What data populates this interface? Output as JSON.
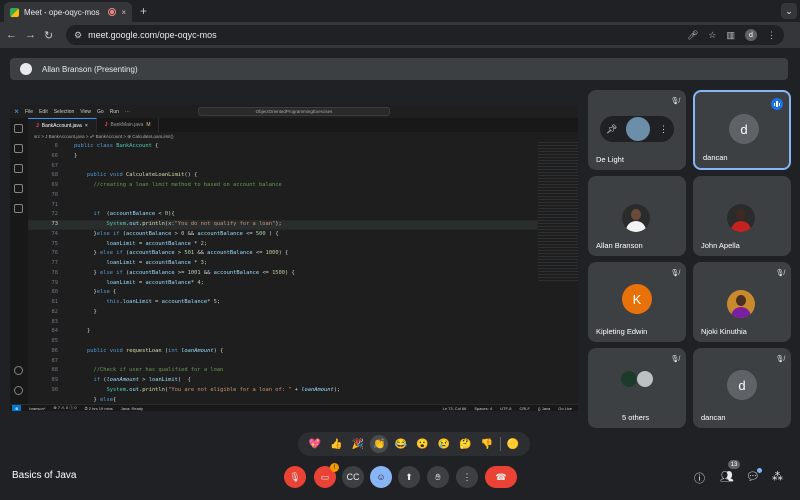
{
  "browser": {
    "tab_title": "Meet - ope-oqyc-mos",
    "new_tab": "+",
    "tab_menu": "⌄",
    "url": "meet.google.com/ope-oqyc-mos",
    "profile_initial": "d"
  },
  "banner": {
    "text": "Allan Branson (Presenting)"
  },
  "vscode": {
    "menu": [
      "File",
      "Edit",
      "Selection",
      "View",
      "Go",
      "Run",
      "···"
    ],
    "search": "ObjectOrientedProgrammingExercises",
    "tabs": [
      {
        "label": "BankAccount.java",
        "close": "×",
        "active": true
      },
      {
        "label": "BankMain.java",
        "close": "M",
        "active": false
      }
    ],
    "breadcrumb": "src > J BankAccount.java > ☍ BankAccount > ⊕ CalculateLoanLimit()",
    "line_numbers": [
      "6",
      "66",
      "67",
      "68",
      "69",
      "70",
      "71",
      "72",
      "73",
      "74",
      "75",
      "76",
      "77",
      "78",
      "79",
      "80",
      "81",
      "82",
      "83",
      "84",
      "85",
      "86",
      "87",
      "88",
      "89",
      "90"
    ],
    "status": {
      "remote": "⊗",
      "branch": "branson*",
      "problems": "⊗ 7 ⚠ 0 ⓘ 0",
      "time": "⏱ 2 hrs 19 mins",
      "java": "Java: Ready",
      "position": "Ln 73, Col 66",
      "spaces": "Spaces: 4",
      "encoding": "UTF-8",
      "eol": "CRLF",
      "lang": "{} Java",
      "golive": "Go Live"
    }
  },
  "participants": [
    {
      "name": "De Light",
      "muted": true,
      "type": "controls"
    },
    {
      "name": "dancan",
      "initial": "d",
      "speaking": true,
      "type": "letter",
      "color": "#5f6368"
    },
    {
      "name": "Allan Branson",
      "type": "photo"
    },
    {
      "name": "John Apella",
      "type": "photo"
    },
    {
      "name": "Kipleting Edwin",
      "initial": "K",
      "muted": true,
      "type": "letter",
      "color": "#e8710a"
    },
    {
      "name": "Njoki Kinuthia",
      "muted": true,
      "type": "photo"
    },
    {
      "name": "5 others",
      "muted": true,
      "type": "others"
    },
    {
      "name": "dancan",
      "initial": "d",
      "muted": true,
      "type": "letter",
      "color": "#5f6368"
    }
  ],
  "reactions": [
    "💖",
    "👍",
    "🎉",
    "👏",
    "😂",
    "😮",
    "😢",
    "🤔",
    "👎",
    "🟡"
  ],
  "meeting": {
    "title": "Basics of Java",
    "participant_count": "13",
    "notification_badge": "!"
  }
}
